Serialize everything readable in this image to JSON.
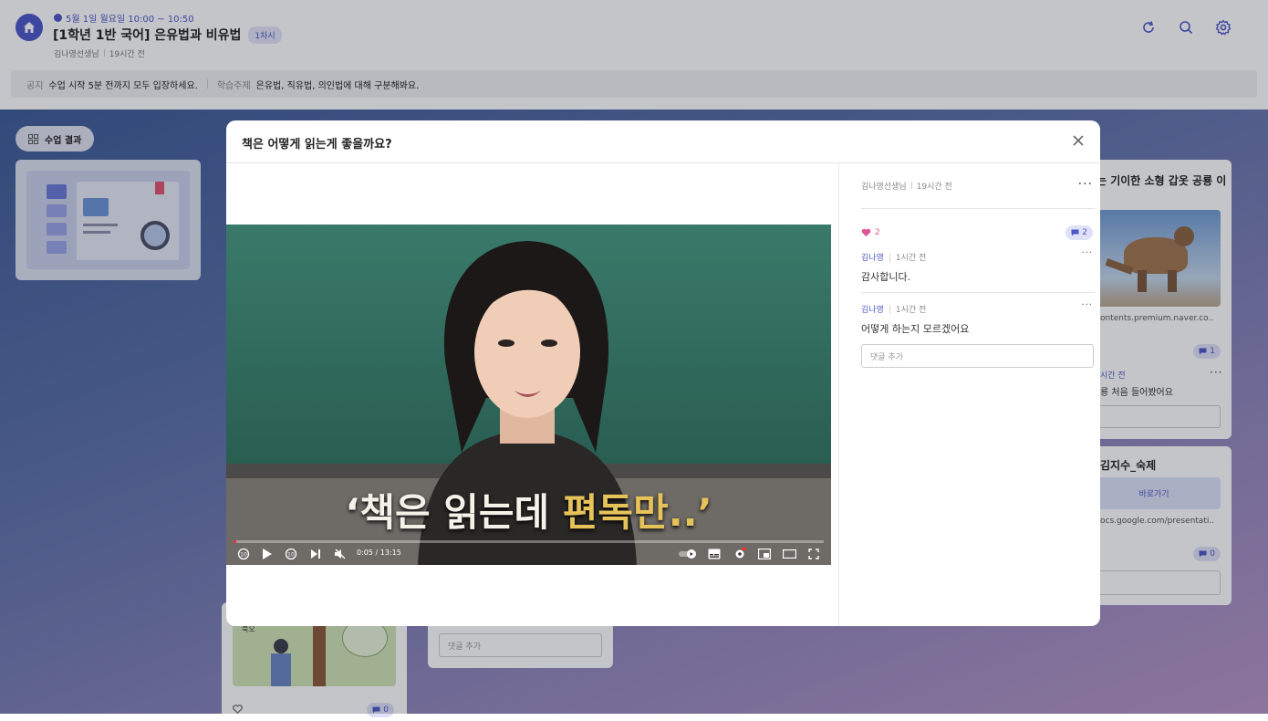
{
  "header": {
    "time": "5월 1일 월요일 10:00 ~ 10:50",
    "title": "[1학년 1반 국어] 은유법과 비유법",
    "session_badge": "1차시",
    "teacher": "김나영선생님",
    "posted": "19시간 전"
  },
  "notice": {
    "notice_label": "공지",
    "notice_text": "수업 시작 5분 전까지 모두 입장하세요.",
    "topic_label": "학습주제",
    "topic_text": "은유법, 직유법, 의인법에 대해 구분해봐요."
  },
  "board": {
    "results_label": "수업 결과",
    "bottom_comment_placeholder": "댓글 추가",
    "bottom_comment_count": "0",
    "right_cards": {
      "title_1": "는 기이한 소형 갑옷 공룡 이",
      "link_1": "ontents.premium.naver.co..",
      "comment_count_1": "1",
      "reply_time": "시간 전",
      "reply_text": "룡 처음 들어봤어요",
      "title_2": "김지수_숙제",
      "goto_label": "바로가기",
      "link_2": "ocs.google.com/presentati..",
      "comment_count_2": "0"
    },
    "illustration_label": "북오"
  },
  "modal": {
    "title": "책은 어떻게 읽는게 좋을까요?",
    "author": "김나영선생님",
    "posted": "19시간 전",
    "likes": "2",
    "comments_count": "2",
    "comments": [
      {
        "author": "김나영",
        "time": "1시간 전",
        "text": "감사합니다."
      },
      {
        "author": "김나영",
        "time": "1시간 전",
        "text": "어떻게 하는지 모르겠어요"
      }
    ],
    "comment_placeholder": "댓글 추가"
  },
  "video": {
    "caption_plain": "‘책은 읽는데 ",
    "caption_highlight": "편독만..’",
    "time": "0:05 / 13:15"
  },
  "colors": {
    "accent": "#4c57c7",
    "heart": "#e0559a"
  }
}
